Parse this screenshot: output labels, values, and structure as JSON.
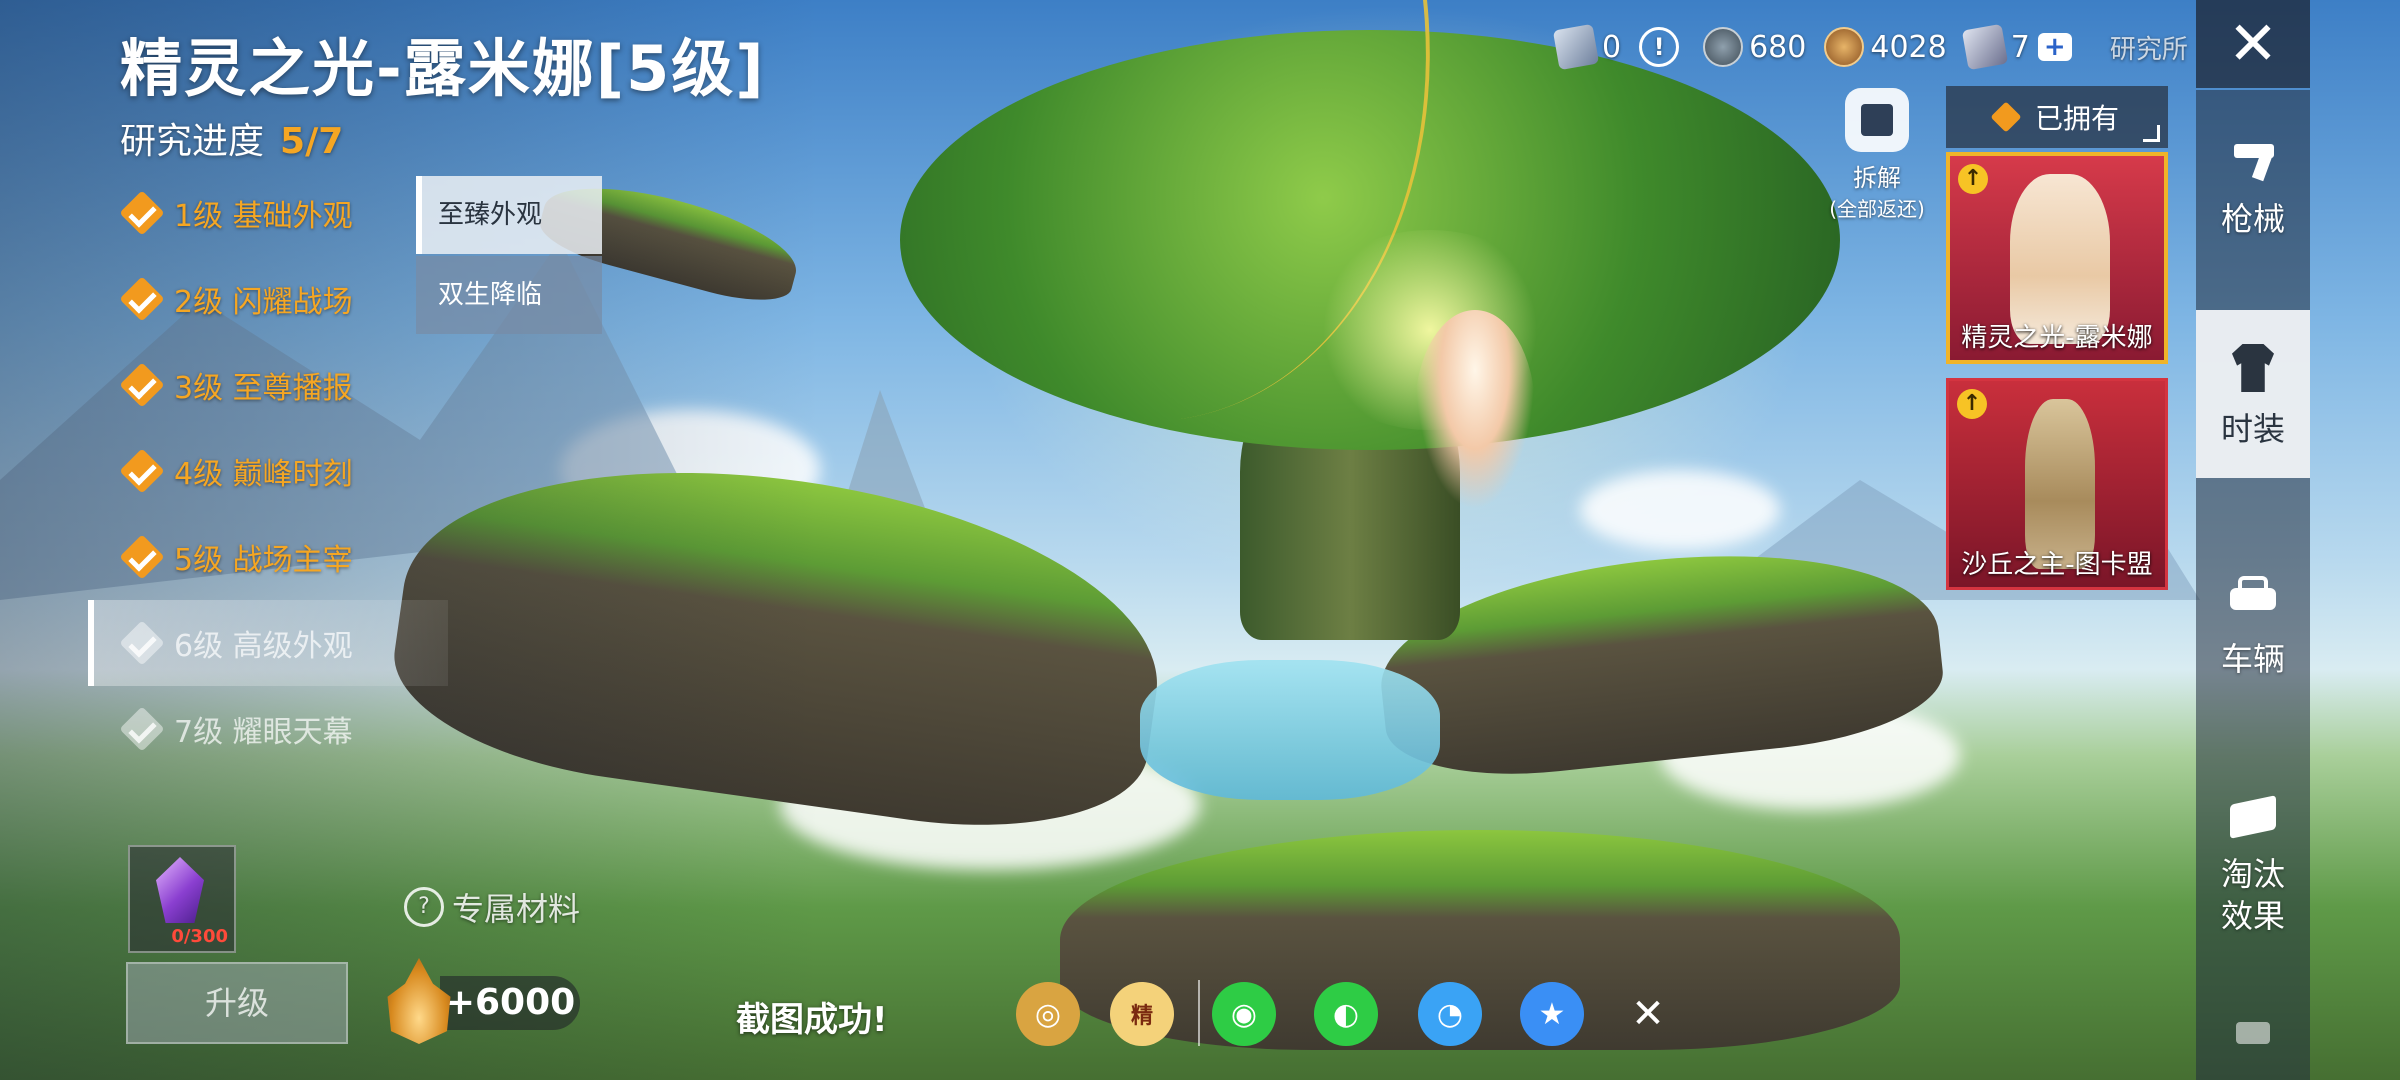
{
  "header": {
    "title": "精灵之光-露米娜[5级]",
    "progress_label": "研究进度",
    "progress_value": "5/7"
  },
  "levels": [
    {
      "label": "1级 基础外观",
      "state": "done"
    },
    {
      "label": "2级 闪耀战场",
      "state": "done"
    },
    {
      "label": "3级 至尊播报",
      "state": "done"
    },
    {
      "label": "4级 巅峰时刻",
      "state": "done"
    },
    {
      "label": "5级 战场主宰",
      "state": "done"
    },
    {
      "label": "6级 高级外观",
      "state": "locked-selected"
    },
    {
      "label": "7级 耀眼天幕",
      "state": "locked"
    }
  ],
  "subtabs": [
    {
      "label": "至臻外观",
      "active": true
    },
    {
      "label": "双生降临",
      "active": false
    }
  ],
  "material": {
    "count": "0/300",
    "exclusive_label": "专属材料",
    "help_icon": "?"
  },
  "upgrade_label": "升级",
  "bonus_value": "+6000",
  "share_bar": {
    "toast": "截图成功!",
    "buttons": [
      {
        "name": "share-app-icon",
        "glyph": "◎",
        "color": "#d9a441"
      },
      {
        "name": "share-peace-elite-icon",
        "glyph": "精",
        "color": "#f0c060"
      },
      {
        "name": "share-wechat-icon",
        "glyph": "◉",
        "color": "#2ecc45"
      },
      {
        "name": "share-moments-icon",
        "glyph": "◐",
        "color": "#2ecc45"
      },
      {
        "name": "share-qq-icon",
        "glyph": "◔",
        "color": "#3aa3f5"
      },
      {
        "name": "share-qzone-icon",
        "glyph": "★",
        "color": "#3a8ff5"
      }
    ],
    "close_glyph": "✕"
  },
  "currency": {
    "card_count": "0",
    "warn_glyph": "!",
    "silver": "680",
    "gold": "4028",
    "ticket": "7",
    "plus_glyph": "+",
    "lab_link": "研究所"
  },
  "dismantle": {
    "label": "拆解",
    "sub": "(全部返还)"
  },
  "owned_filter": "已拥有",
  "cards": [
    {
      "name": "精灵之光-露米娜",
      "badge": "↑"
    },
    {
      "name": "沙丘之主-图卡盟",
      "badge": "↑"
    }
  ],
  "close_glyph": "✕",
  "nav": [
    {
      "label": "枪械",
      "icon": "gun-icon",
      "active": false
    },
    {
      "label": "时装",
      "icon": "outfit-icon",
      "active": true
    },
    {
      "label": "车辆",
      "icon": "vehicle-icon",
      "active": false
    },
    {
      "label": "淘汰\n效果",
      "line1": "淘汰",
      "line2": "效果",
      "icon": "elimination-effect-icon",
      "active": false
    }
  ],
  "colors": {
    "accent_orange": "#f5a623",
    "card_gold_border": "#f0b429",
    "card_red": "#d43440"
  }
}
